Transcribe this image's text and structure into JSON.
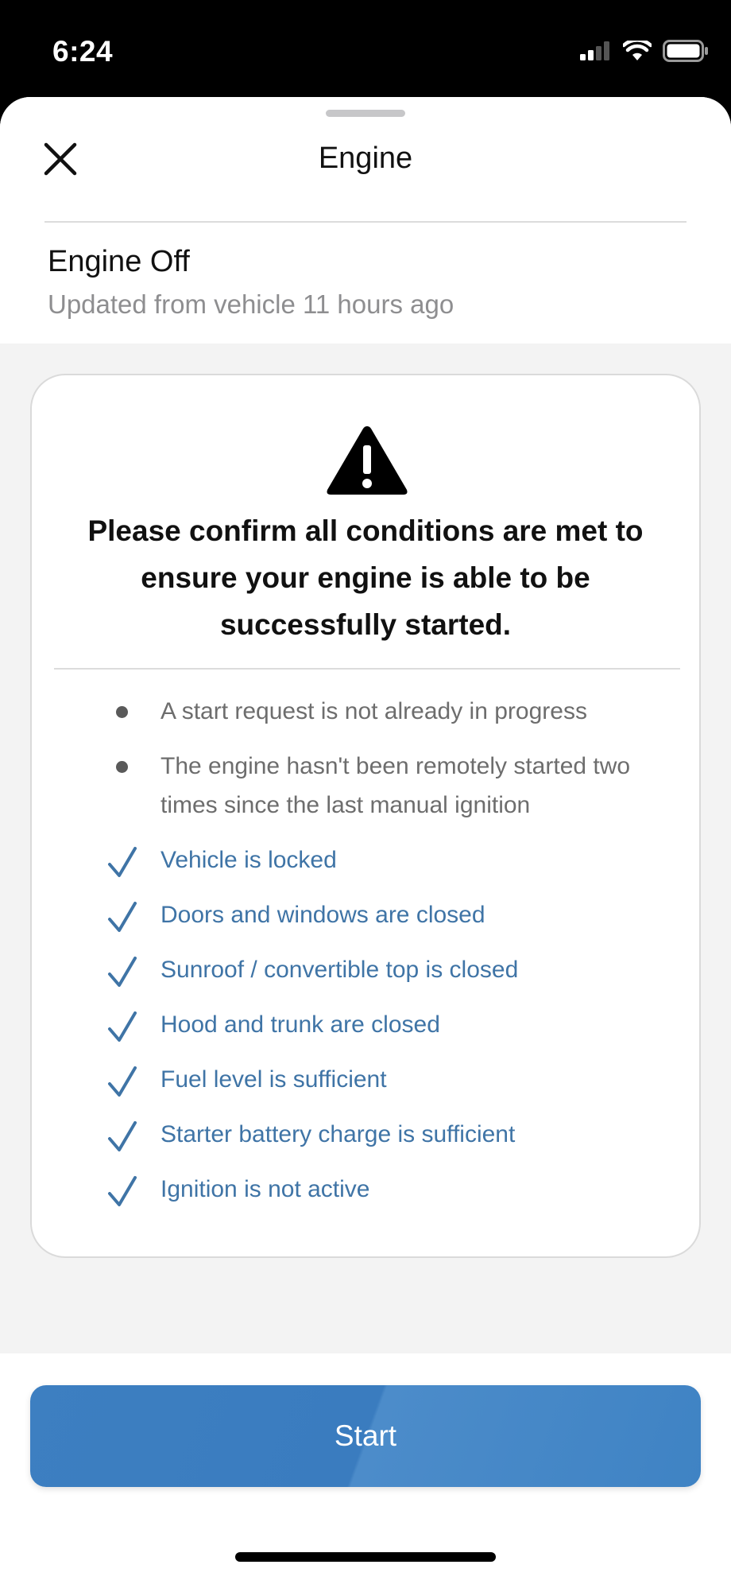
{
  "status_bar": {
    "time": "6:24"
  },
  "header": {
    "title": "Engine",
    "close_icon": "close-icon"
  },
  "engine_status": {
    "title": "Engine Off",
    "subtitle": "Updated from vehicle 11 hours ago"
  },
  "card": {
    "icon": "warning-icon",
    "heading": "Please confirm all conditions are met to ensure your engine is able to be successfully started.",
    "conditions": [
      {
        "text": "A start request is not already in progress",
        "state": "pending"
      },
      {
        "text": "The engine hasn't been remotely started two times since the last manual ignition",
        "state": "pending"
      },
      {
        "text": "Vehicle is locked",
        "state": "met"
      },
      {
        "text": "Doors and windows are closed",
        "state": "met"
      },
      {
        "text": "Sunroof / convertible top is closed",
        "state": "met"
      },
      {
        "text": "Hood and trunk are closed",
        "state": "met"
      },
      {
        "text": "Fuel level is sufficient",
        "state": "met"
      },
      {
        "text": "Starter battery charge is sufficient",
        "state": "met"
      },
      {
        "text": "Ignition is not active",
        "state": "met"
      }
    ]
  },
  "actions": {
    "start_label": "Start"
  },
  "colors": {
    "accent": "#3d7fc1",
    "met_text": "#3f74a6",
    "pending_text": "#6d6d6d"
  }
}
